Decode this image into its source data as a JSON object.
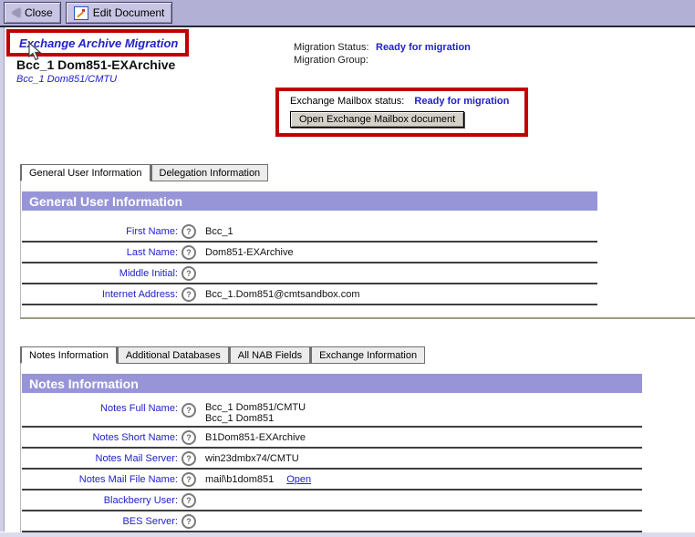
{
  "toolbar": {
    "close_label": "Close",
    "edit_label": "Edit Document"
  },
  "header": {
    "title": "Exchange Archive Migration",
    "display_name": "Bcc_1 Dom851-EXArchive",
    "notes_name": "Bcc_1 Dom851/CMTU",
    "migration_status_label": "Migration Status:",
    "migration_status_value": "Ready for migration",
    "migration_group_label": "Migration Group:",
    "migration_group_value": "",
    "mailbox_status_label": "Exchange Mailbox status:",
    "mailbox_status_value": "Ready for migration",
    "open_mailbox_button": "Open Exchange Mailbox document"
  },
  "icons": {
    "help": "?"
  },
  "user_section": {
    "tabs": [
      {
        "label": "General User Information"
      },
      {
        "label": "Delegation Information"
      }
    ],
    "header": "General User Information",
    "fields": [
      {
        "label": "First Name:",
        "value": "Bcc_1"
      },
      {
        "label": "Last Name:",
        "value": "Dom851-EXArchive"
      },
      {
        "label": "Middle Initial:",
        "value": ""
      },
      {
        "label": "Internet Address:",
        "value": "Bcc_1.Dom851@cmtsandbox.com"
      }
    ]
  },
  "notes_section": {
    "tabs": [
      {
        "label": "Notes Information"
      },
      {
        "label": "Additional Databases"
      },
      {
        "label": "All NAB Fields"
      },
      {
        "label": "Exchange Information"
      }
    ],
    "header": "Notes Information",
    "fields": [
      {
        "label": "Notes Full Name:",
        "value": "Bcc_1 Dom851/CMTU",
        "value2": "Bcc_1 Dom851"
      },
      {
        "label": "Notes Short Name:",
        "value": "B1Dom851-EXArchive"
      },
      {
        "label": "Notes Mail Server:",
        "value": "win23dmbx74/CMTU"
      },
      {
        "label": "Notes Mail File Name:",
        "value": "mail\\b1dom851",
        "link": "Open"
      },
      {
        "label": "Blackberry User:",
        "value": ""
      },
      {
        "label": "BES Server:",
        "value": ""
      }
    ]
  },
  "colors": {
    "accent_red": "#c00000",
    "section_bar": "#9795d8",
    "toolbar": "#b2b0d5",
    "link_blue": "#2121c8",
    "status_blue": "#2121c8"
  }
}
